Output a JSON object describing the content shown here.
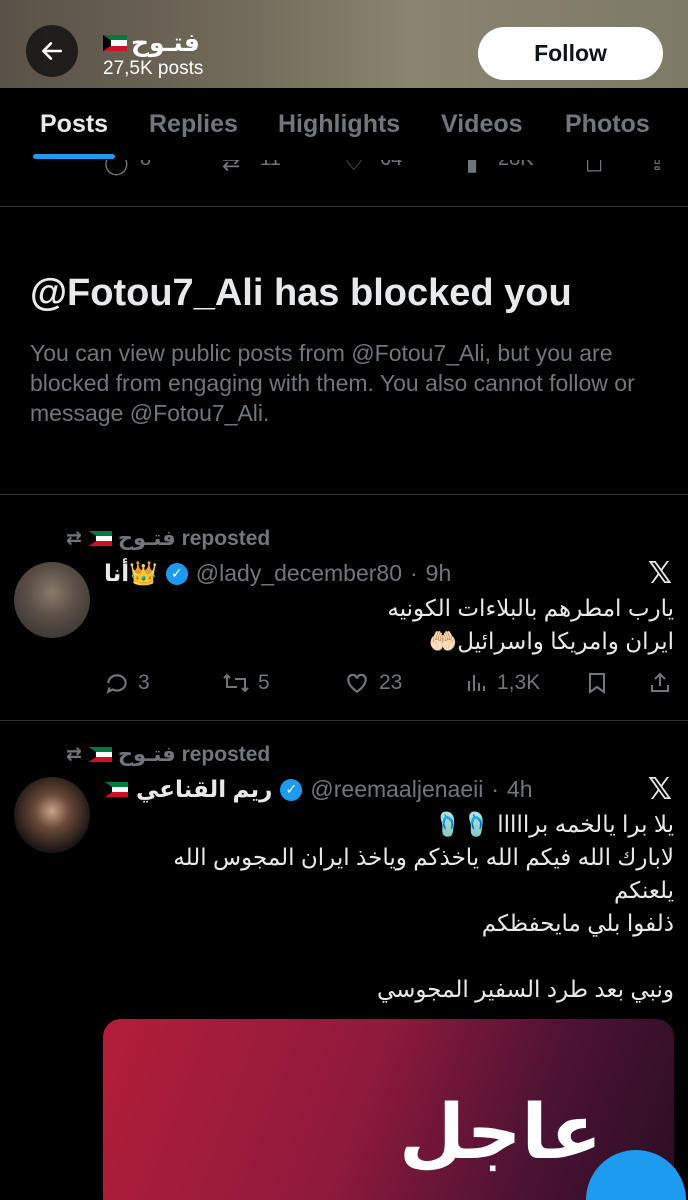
{
  "header": {
    "profile_name": "فتـوح",
    "post_count": "27,5K posts",
    "follow_label": "Follow"
  },
  "tabs": [
    {
      "label": "Posts",
      "active": true
    },
    {
      "label": "Replies",
      "active": false
    },
    {
      "label": "Highlights",
      "active": false
    },
    {
      "label": "Videos",
      "active": false
    },
    {
      "label": "Photos",
      "active": false
    }
  ],
  "previous_post_actions": {
    "replies": "8",
    "reposts": "11",
    "likes": "64",
    "views": "28K"
  },
  "blocked": {
    "title": "@Fotou7_Ali has blocked you",
    "message": "You can view public posts from @Fotou7_Ali, but you are blocked from engaging with them. You also cannot follow or message @Fotou7_Ali."
  },
  "posts": [
    {
      "repost_label": "فتـوح reposted",
      "author_name": "أنا👑",
      "handle": "@lady_december80",
      "time": "9h",
      "lines": [
        "يارب امطرهم بالبلاءات الكونيه",
        "ايران وامريكا واسرائيل🤲🏻"
      ],
      "replies": "3",
      "reposts": "5",
      "likes": "23",
      "views": "1,3K"
    },
    {
      "repost_label": "فتـوح reposted",
      "author_name": "ريم القناعي",
      "handle": "@reemaaljenaeii",
      "time": "4h",
      "lines": [
        "يلا برا يالخمه برااااا 🩴🩴",
        "لابارك الله فيكم الله ياخذكم وياخذ ايران المجوس الله",
        "يلعنكم",
        "ذلفوا بلي مايحفظكم",
        "",
        "ونبي بعد طرد السفير المجوسي"
      ],
      "media_word": "عاجل"
    }
  ],
  "colors": {
    "accent": "#1d9bf0",
    "muted": "#71767b",
    "text": "#e7e9ea",
    "background": "#000000"
  }
}
